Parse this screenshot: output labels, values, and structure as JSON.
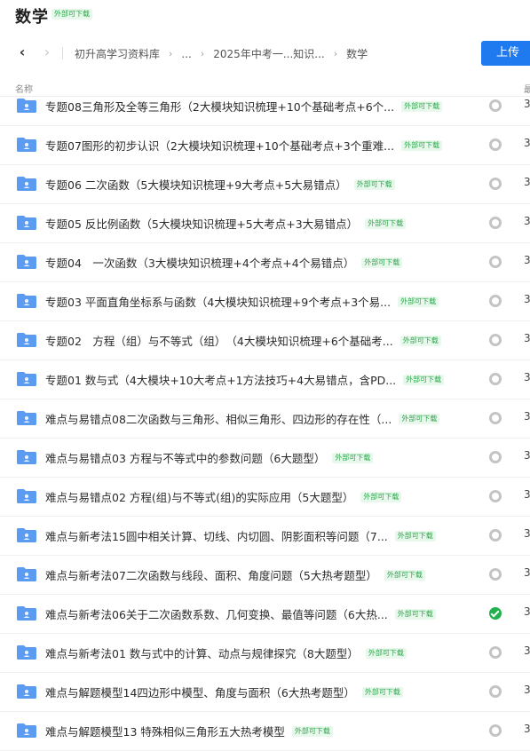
{
  "header": {
    "title": "数学",
    "title_badge": "外部可下载"
  },
  "breadcrumb": {
    "back_icon": "chevron-left-icon",
    "forward_icon": "chevron-right-icon",
    "items": [
      "初升高学习资料库",
      "...",
      "2025年中考一...知识...",
      "数学"
    ]
  },
  "upload_label": "上传",
  "columns": {
    "name": "名称",
    "right": "最"
  },
  "badge_text": "外部可下载",
  "colors": {
    "accent": "#1f7af0",
    "badge_bg": "#e9f8ec",
    "badge_text": "#2aa54a",
    "folder": "#5b9cf0",
    "done": "#22b14c"
  },
  "rows": [
    {
      "name": "专题08三角形及全等三角形（2大模块知识梳理+10个基础考点+6个...",
      "status": "pending",
      "right": "3"
    },
    {
      "name": "专题07图形的初步认识（2大模块知识梳理+10个基础考点+3个重难...",
      "status": "pending",
      "right": "3"
    },
    {
      "name": "专题06 二次函数（5大模块知识梳理+9大考点+5大易错点）",
      "status": "pending",
      "right": "3"
    },
    {
      "name": "专题05 反比例函数（5大模块知识梳理+5大考点+3大易错点）",
      "status": "pending",
      "right": "3"
    },
    {
      "name": "专题04　一次函数（3大模块知识梳理+4个考点+4个易错点）",
      "status": "pending",
      "right": "3"
    },
    {
      "name": "专题03 平面直角坐标系与函数（4大模块知识梳理+9个考点+3个易...",
      "status": "pending",
      "right": "3"
    },
    {
      "name": "专题02　方程（组）与不等式（组）　（4大模块知识梳理+6个基础考...",
      "status": "pending",
      "right": "3"
    },
    {
      "name": "专题01 数与式（4大模块+10大考点+1方法技巧+4大易错点，含PD...",
      "status": "pending",
      "right": "3"
    },
    {
      "name": "难点与易错点08二次函数与三角形、相似三角形、四边形的存在性（...",
      "status": "pending",
      "right": "3"
    },
    {
      "name": "难点与易错点03 方程与不等式中的参数问题（6大题型）",
      "status": "pending",
      "right": "3"
    },
    {
      "name": "难点与易错点02 方程(组)与不等式(组)的实际应用（5大题型）",
      "status": "pending",
      "right": "3"
    },
    {
      "name": "难点与新考法15圆中相关计算、切线、内切圆、阴影面积等问题（7...",
      "status": "pending",
      "right": "3"
    },
    {
      "name": "难点与新考法07二次函数与线段、面积、角度问题（5大热考题型）",
      "status": "pending",
      "right": "3"
    },
    {
      "name": "难点与新考法06关于二次函数系数、几何变换、最值等问题（6大热...",
      "status": "done",
      "right": "3"
    },
    {
      "name": "难点与新考法01 数与式中的计算、动点与规律探究（8大题型）",
      "status": "pending",
      "right": "3"
    },
    {
      "name": "难点与解题模型14四边形中模型、角度与面积（6大热考题型）",
      "status": "pending",
      "right": "3"
    },
    {
      "name": "难点与解题模型13 特殊相似三角形五大热考模型",
      "status": "pending",
      "right": "3"
    }
  ]
}
